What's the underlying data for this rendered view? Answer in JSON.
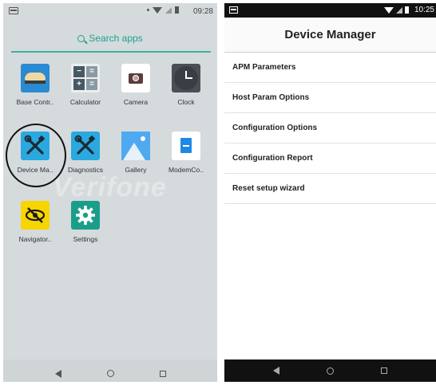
{
  "left_phone": {
    "status_time": "09:28",
    "search_label": "Search apps",
    "watermark": "Verifone",
    "apps": [
      {
        "label": "Base Contr..",
        "icon": "base-controller-icon"
      },
      {
        "label": "Calculator",
        "icon": "calculator-icon"
      },
      {
        "label": "Camera",
        "icon": "camera-icon"
      },
      {
        "label": "Clock",
        "icon": "clock-icon"
      },
      {
        "label": "Device Ma..",
        "icon": "device-manager-icon"
      },
      {
        "label": "Diagnostics",
        "icon": "diagnostics-icon"
      },
      {
        "label": "Gallery",
        "icon": "gallery-icon"
      },
      {
        "label": "ModemCo..",
        "icon": "modem-config-icon"
      },
      {
        "label": "Navigator..",
        "icon": "navigator-icon"
      },
      {
        "label": "Settings",
        "icon": "settings-icon"
      }
    ],
    "calc_keys": [
      "−",
      "=",
      "+",
      "="
    ]
  },
  "right_phone": {
    "status_time": "10:25",
    "title": "Device Manager",
    "menu": [
      "APM Parameters",
      "Host Param Options",
      "Configuration Options",
      "Configuration Report",
      "Reset setup wizard"
    ]
  },
  "colors": {
    "accent_teal": "#1aa58a",
    "tool_blue": "#2aa8e0",
    "navigator_yellow": "#f6d500"
  }
}
